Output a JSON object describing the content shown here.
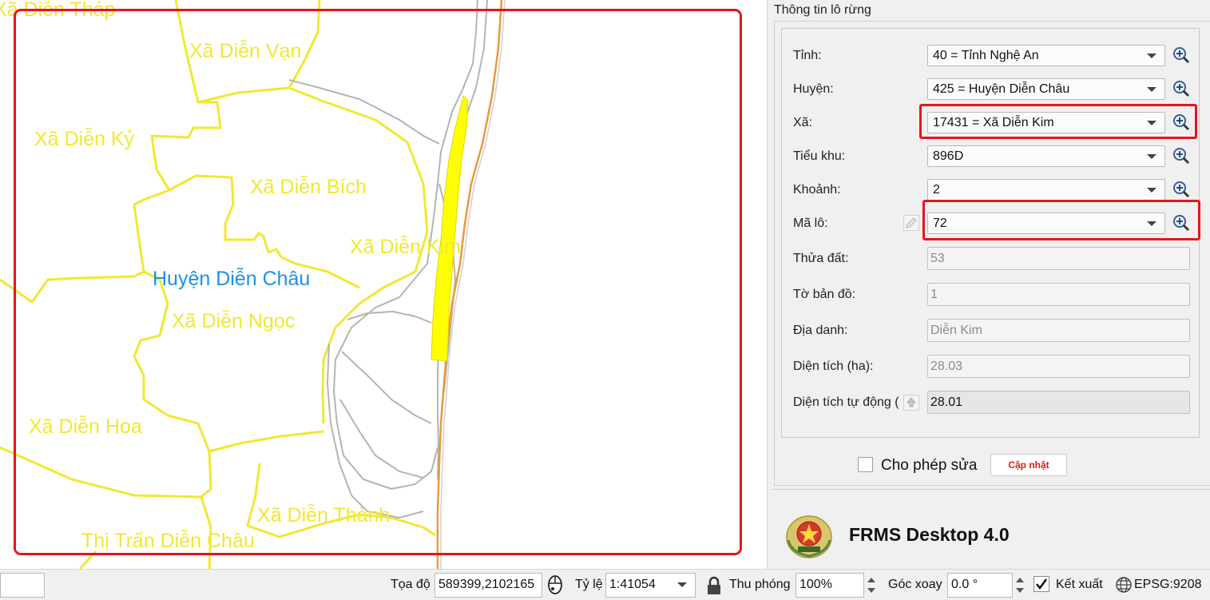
{
  "map": {
    "labels": [
      {
        "text": "Xã Diễn Tháp",
        "kind": "commune"
      },
      {
        "text": "Xã Diễn Vạn",
        "kind": "commune"
      },
      {
        "text": "Xã Diễn Kỷ",
        "kind": "commune"
      },
      {
        "text": "Xã Diễn Bích",
        "kind": "commune"
      },
      {
        "text": "Xã Diễn Kim",
        "kind": "commune"
      },
      {
        "text": "Huyện Diễn Châu",
        "kind": "district"
      },
      {
        "text": "Xã Diễn Ngọc",
        "kind": "commune"
      },
      {
        "text": "Xã Diễn Hoa",
        "kind": "commune"
      },
      {
        "text": "Xã Diễn Thành",
        "kind": "commune"
      },
      {
        "text": "Thị Trấn Diễn Châu",
        "kind": "commune"
      }
    ],
    "colors": {
      "boundary": "#f1e832",
      "parcel": "#ffff00",
      "road": "#b4b4b4",
      "coast": "#e89a3a",
      "highlight": "#e8141a"
    }
  },
  "panel": {
    "group_title": "Thông tin lô rừng",
    "fields": {
      "tinh": {
        "label": "Tỉnh:",
        "value": "40 = Tỉnh Nghệ An"
      },
      "huyen": {
        "label": "Huyện:",
        "value": "425 = Huyện Diễn Châu"
      },
      "xa": {
        "label": "Xã:",
        "value": "17431 = Xã Diễn Kim"
      },
      "tieukhu": {
        "label": "Tiểu khu:",
        "value": "896D"
      },
      "khoanh": {
        "label": "Khoảnh:",
        "value": "2"
      },
      "malo": {
        "label": "Mã lô:",
        "value": "72"
      },
      "thuadat": {
        "label": "Thửa đất:",
        "value": "53"
      },
      "tobando": {
        "label": "Tờ bản đồ:",
        "value": "1"
      },
      "diadanh": {
        "label": "Địa danh:",
        "value": "Diễn Kim"
      },
      "dientich": {
        "label": "Diện tích (ha):",
        "value": "28.03"
      },
      "dientich_auto": {
        "label": "Diện tích tự động (",
        "value": "28.01"
      }
    },
    "allow_edit_label": "Cho phép sửa",
    "update_button": "Cập nhật",
    "app_title": "FRMS Desktop 4.0"
  },
  "statusbar": {
    "coord_label": "Tọa độ",
    "coord_value": "589399,2102165",
    "scale_label": "Tỷ lệ",
    "scale_value": "1:41054",
    "zoom_label": "Thu phóng",
    "zoom_value": "100%",
    "rotation_label": "Góc xoay",
    "rotation_value": "0.0 °",
    "render_label": "Kết xuất",
    "epsg_value": "EPSG:9208"
  }
}
